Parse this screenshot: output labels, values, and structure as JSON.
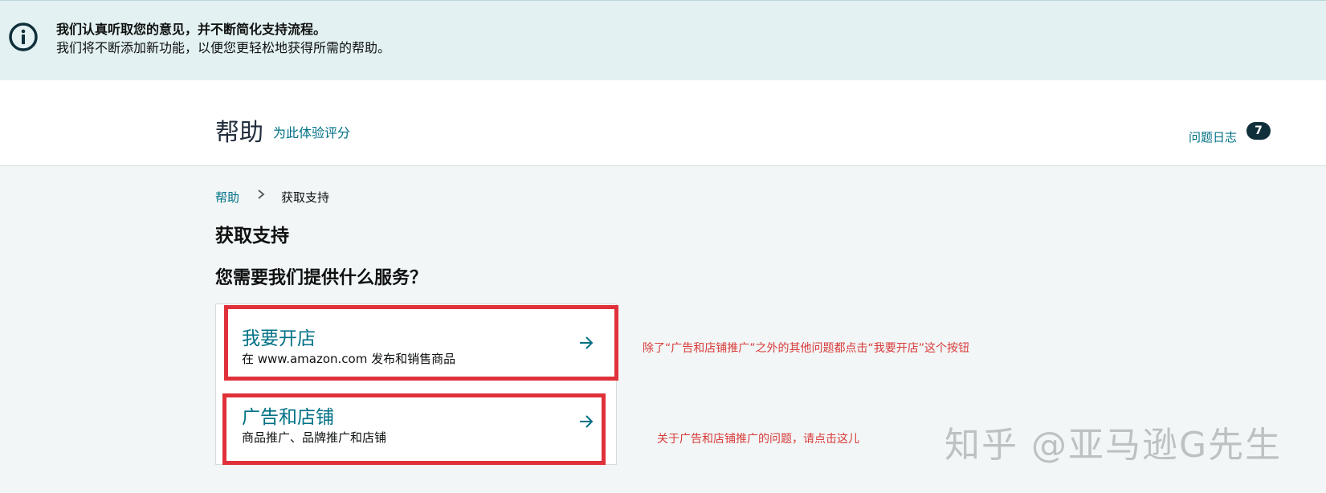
{
  "banner": {
    "icon": "info-icon",
    "line1": "我们认真听取您的意见，并不断简化支持流程。",
    "line2": "我们将不断添加新功能，以便您更轻松地获得所需的帮助。"
  },
  "header": {
    "title": "帮助",
    "rate_link": "为此体验评分",
    "issue_log": "问题日志",
    "issue_count": "7"
  },
  "breadcrumb": {
    "home": "帮助",
    "current": "获取支持"
  },
  "page": {
    "heading": "获取支持",
    "question": "您需要我们提供什么服务？"
  },
  "cards": [
    {
      "title": "我要开店",
      "description": "在 www.amazon.com 发布和销售商品"
    },
    {
      "title": "广告和店铺",
      "description": "商品推广、品牌推广和店铺"
    }
  ],
  "annotations": {
    "note1": "除了“广告和店铺推广”之外的其他问题都点击“我要开店”这个按钮",
    "note2": "关于广告和店铺推广的问题，请点击这儿",
    "watermark": "知乎 @亚马逊G先生"
  },
  "colors": {
    "accent": "#007185",
    "annotation_red": "#e0313a",
    "banner_bg": "#e3f1f2"
  }
}
